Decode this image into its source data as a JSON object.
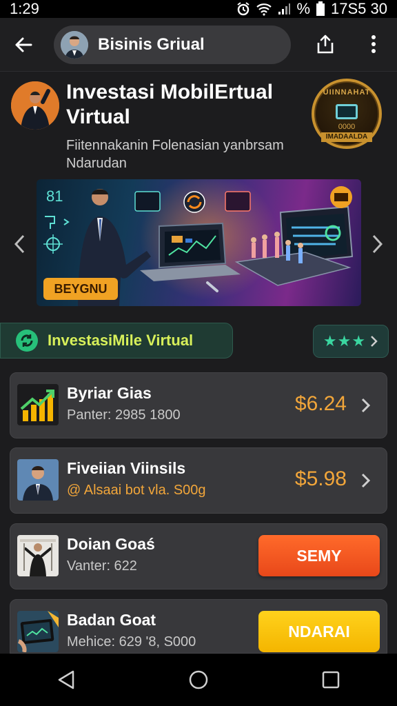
{
  "status_bar": {
    "time": "1:29",
    "right_text": "%",
    "clock": "17S5 30"
  },
  "app_bar": {
    "title": "Bisinis Griual",
    "icons": {
      "back": "back-arrow-icon",
      "share": "share-icon",
      "more": "more-vert-icon"
    }
  },
  "header": {
    "headline": "Investasi MobilErtual Virtual",
    "subline": "Fiitennakanin Folenasian yanbrsam Ndarudan",
    "badge": {
      "top": "UIINNAHAT",
      "number": "0000",
      "bottom": "IMADAALDA"
    }
  },
  "banner": {
    "number": "81",
    "button_label": "BEYGNU"
  },
  "highlight": {
    "label": "InvestasiMile Virtual",
    "rating": "★★★",
    "colors": {
      "accent": "#d7f05a",
      "icon": "#27c07a"
    }
  },
  "list": [
    {
      "title": "Byriar Gias",
      "subtitle": "Panter: 2985 1800",
      "price": "$6.24",
      "action": ""
    },
    {
      "title": "Fiveiian Viinsils",
      "subtitle": "@ Alsaai bot vla. S00g",
      "price": "$5.98",
      "action": ""
    },
    {
      "title": "Doian Goaś",
      "subtitle": "Vanter: 622",
      "price": "",
      "action": "SEMY"
    },
    {
      "title": "Badan Goat",
      "subtitle": "Mehice: 629  '8, S000",
      "price": "",
      "action": "NDARAI"
    }
  ],
  "colors": {
    "price": "#f2a63a",
    "btn_orange": "#e8481a",
    "btn_yellow": "#f4b500"
  },
  "nav_bar": {
    "icons": [
      "nav-back-icon",
      "nav-home-icon",
      "nav-recents-icon"
    ]
  }
}
